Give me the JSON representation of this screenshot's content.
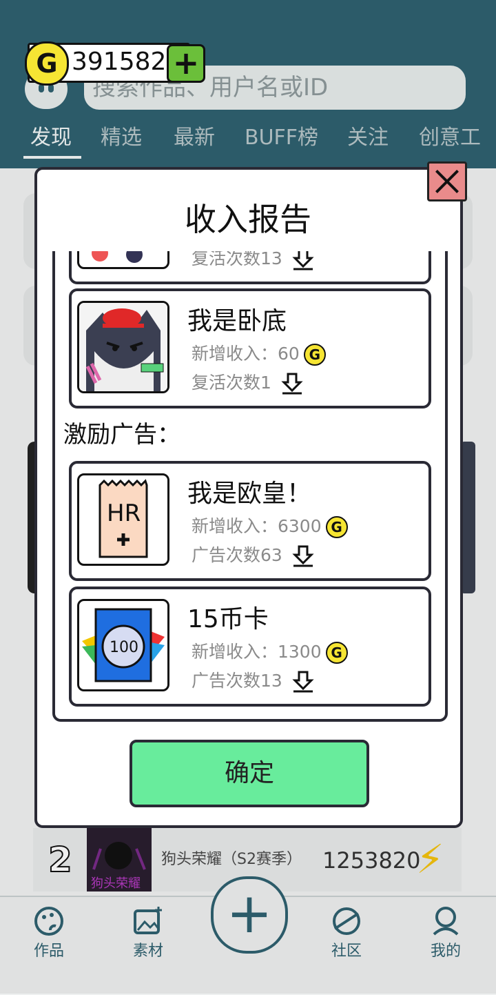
{
  "balance": {
    "coin_symbol": "G",
    "amount": "391582",
    "add_symbol": "+"
  },
  "search": {
    "placeholder": "搜索作品、用户名或ID"
  },
  "tabs": [
    {
      "label": "发现",
      "active": true
    },
    {
      "label": "精选"
    },
    {
      "label": "最新"
    },
    {
      "label": "BUFF榜"
    },
    {
      "label": "关注"
    },
    {
      "label": "创意工"
    }
  ],
  "dialog": {
    "title": "收入报告",
    "partial_item_count": "复活次数13",
    "items": [
      {
        "name": "我是卧底",
        "income_label": "新增收入：60",
        "count_label": "复活次数1",
        "icon": "download-icon"
      }
    ],
    "section_label": "激励广告：",
    "ad_items": [
      {
        "name": "我是欧皇！",
        "income_label": "新增收入：6300",
        "count_label": "广告次数63",
        "thumb_text": "HR",
        "icon": "download-icon"
      },
      {
        "name": "15币卡",
        "income_label": "新增收入：1300",
        "count_label": "广告次数13",
        "thumb_text": "100",
        "icon": "download-icon"
      }
    ],
    "coin_symbol": "G",
    "confirm_label": "确定"
  },
  "ranking": {
    "rank": "2",
    "name": "狗头荣耀（S2赛季）",
    "score": "1253820",
    "thumb_caption": "狗头荣耀"
  },
  "bottom_nav": [
    {
      "label": "作品",
      "icon": "palette-icon"
    },
    {
      "label": "素材",
      "icon": "image-icon"
    },
    {
      "label": "社区",
      "icon": "planet-icon"
    },
    {
      "label": "我的",
      "icon": "user-icon"
    }
  ],
  "colors": {
    "header": "#2f6170",
    "confirm": "#68ec9c",
    "close": "#e98b8b",
    "coin": "#f6e533"
  }
}
